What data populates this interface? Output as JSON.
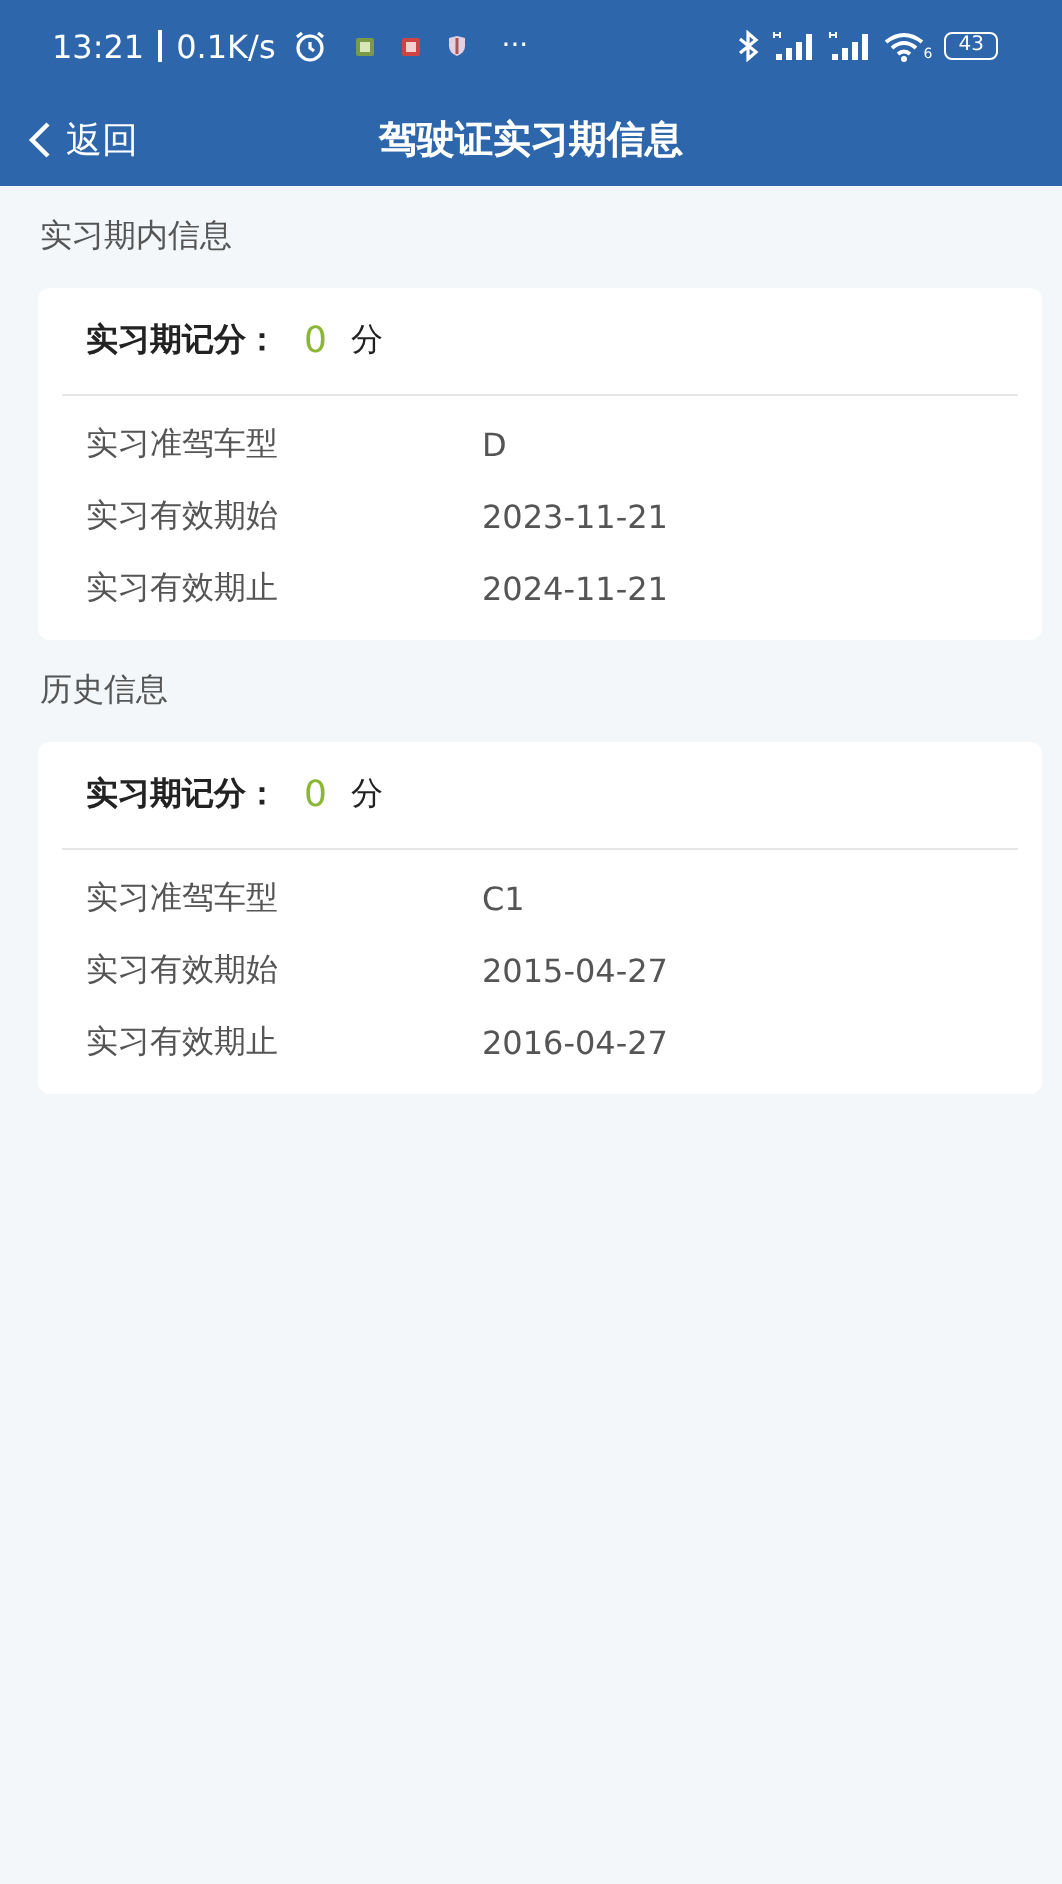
{
  "status_bar": {
    "time": "13:21",
    "speed": "0.1K/s",
    "more": "···",
    "wifi_badge": "6",
    "battery": "43"
  },
  "nav": {
    "back": "返回",
    "title": "驾驶证实习期信息"
  },
  "sections": [
    {
      "heading": "实习期内信息",
      "score_label": "实习期记分：",
      "score": "0",
      "score_unit": "分",
      "rows": [
        {
          "label": "实习准驾车型",
          "value": "D"
        },
        {
          "label": "实习有效期始",
          "value": "2023-11-21"
        },
        {
          "label": "实习有效期止",
          "value": "2024-11-21"
        }
      ]
    },
    {
      "heading": "历史信息",
      "score_label": "实习期记分：",
      "score": "0",
      "score_unit": "分",
      "rows": [
        {
          "label": "实习准驾车型",
          "value": "C1"
        },
        {
          "label": "实习有效期始",
          "value": "2015-04-27"
        },
        {
          "label": "实习有效期止",
          "value": "2016-04-27"
        }
      ]
    }
  ]
}
